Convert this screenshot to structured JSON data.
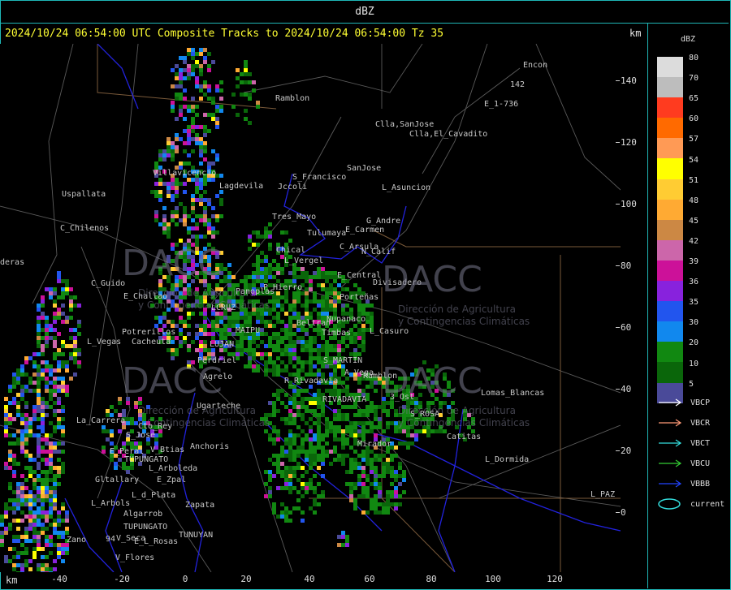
{
  "window": {
    "title": "dBZ"
  },
  "status_line": "2024/10/24 06:54:00 UTC Composite Tracks to 2024/10/24 06:54:00 Tz 35",
  "axis": {
    "unit_top": "km",
    "unit_bottom": "km",
    "y_ticks": [
      "140",
      "120",
      "100",
      "80",
      "60",
      "40",
      "20",
      "0"
    ],
    "x_ticks": [
      "-40",
      "-20",
      "0",
      "20",
      "40",
      "60",
      "80",
      "100",
      "120"
    ]
  },
  "legend": {
    "title": "dBZ",
    "levels": [
      {
        "label": "80",
        "color": "#dcdcdc"
      },
      {
        "label": "70",
        "color": "#bdbdbd"
      },
      {
        "label": "65",
        "color": "#ff3b1f"
      },
      {
        "label": "60",
        "color": "#ff6a00"
      },
      {
        "label": "57",
        "color": "#ff9a55"
      },
      {
        "label": "54",
        "color": "#ffff00"
      },
      {
        "label": "51",
        "color": "#ffcc33"
      },
      {
        "label": "48",
        "color": "#ffaa33"
      },
      {
        "label": "45",
        "color": "#cc8844"
      },
      {
        "label": "42",
        "color": "#cc66aa"
      },
      {
        "label": "39",
        "color": "#cc1199"
      },
      {
        "label": "36",
        "color": "#8822dd"
      },
      {
        "label": "35",
        "color": "#2255ee"
      },
      {
        "label": "30",
        "color": "#1188ee"
      },
      {
        "label": "20",
        "color": "#118811"
      },
      {
        "label": "10",
        "color": "#0a660a"
      },
      {
        "label": "5",
        "color": "#4a4a99"
      }
    ],
    "tracks": [
      {
        "label": "VBCP",
        "color": "#ffffff",
        "icon": "arrow-icon"
      },
      {
        "label": "VBCR",
        "color": "#ff9977",
        "icon": "arrow-icon"
      },
      {
        "label": "VBCT",
        "color": "#33dddd",
        "icon": "arrow-icon"
      },
      {
        "label": "VBCU",
        "color": "#33cc33",
        "icon": "arrow-icon"
      },
      {
        "label": "VBBB",
        "color": "#2244ff",
        "icon": "arrow-icon"
      },
      {
        "label": "current",
        "color": "#33dddd",
        "icon": "ellipse-icon"
      }
    ]
  },
  "places": [
    {
      "name": "Ramblon"
    },
    {
      "name": "Encon"
    },
    {
      "name": "E_1-736"
    },
    {
      "name": "Clla,SanJose"
    },
    {
      "name": "Clla,El_Cavadito"
    },
    {
      "name": "SanJose"
    },
    {
      "name": "S_Francisco"
    },
    {
      "name": "Jccoli"
    },
    {
      "name": "Villavicencio"
    },
    {
      "name": "Lagdevila"
    },
    {
      "name": "Uspallata"
    },
    {
      "name": "L_Asuncion"
    },
    {
      "name": "Tres_Mayo"
    },
    {
      "name": "G_Andre"
    },
    {
      "name": "Tulumaya"
    },
    {
      "name": "E_Carmen"
    },
    {
      "name": "C_Chilenos"
    },
    {
      "name": "C_Arsula"
    },
    {
      "name": "Chical"
    },
    {
      "name": "L_Vergel"
    },
    {
      "name": "N_Calif"
    },
    {
      "name": "E_Central"
    },
    {
      "name": "Divisadero"
    },
    {
      "name": "C_Guido"
    },
    {
      "name": "deras"
    },
    {
      "name": "P_Hierro"
    },
    {
      "name": "Panoplas"
    },
    {
      "name": "E_Challao"
    },
    {
      "name": "Porteñas"
    },
    {
      "name": "LCRUZ"
    },
    {
      "name": "Beltran"
    },
    {
      "name": "Nupanaco"
    },
    {
      "name": "Potrerillos"
    },
    {
      "name": "MAIPU"
    },
    {
      "name": "Timbas"
    },
    {
      "name": "L_Casuro"
    },
    {
      "name": "L_Vegas"
    },
    {
      "name": "Cacheuta"
    },
    {
      "name": "LUJAN"
    },
    {
      "name": "S_MARTIN"
    },
    {
      "name": "Perdriel"
    },
    {
      "name": "Agrelo"
    },
    {
      "name": "A_Vega"
    },
    {
      "name": "Ramblon"
    },
    {
      "name": "R_Rivadavia"
    },
    {
      "name": "Lomas_Blancas"
    },
    {
      "name": "Ugarteche"
    },
    {
      "name": "RIVADAVIA"
    },
    {
      "name": "3_Ost"
    },
    {
      "name": "La_Carrera"
    },
    {
      "name": "Cto_Rey"
    },
    {
      "name": "S_ROSA"
    },
    {
      "name": "S_Jose"
    },
    {
      "name": "Catitas"
    },
    {
      "name": "Anchoris"
    },
    {
      "name": "E_Peral"
    },
    {
      "name": "V_Btias"
    },
    {
      "name": "Mirador"
    },
    {
      "name": "TUPUNGATO"
    },
    {
      "name": "L_Dormida"
    },
    {
      "name": "L_Arboleda"
    },
    {
      "name": "Gltallary"
    },
    {
      "name": "E_Zpal"
    },
    {
      "name": "L_PAZ"
    },
    {
      "name": "L_d_Plata"
    },
    {
      "name": "L_Arbols"
    },
    {
      "name": "Zapata"
    },
    {
      "name": "Algarrob"
    },
    {
      "name": "TUPUNGATO"
    },
    {
      "name": "V_Seca"
    },
    {
      "name": "Zano"
    },
    {
      "name": "E_L_Rosas"
    },
    {
      "name": "TUNUYAN"
    },
    {
      "name": "V_Flores"
    },
    {
      "name": "142"
    },
    {
      "name": "94"
    }
  ],
  "watermark": {
    "logo": "DACC",
    "subtitle_1": "Dirección de Agricultura",
    "subtitle_2": "y Contingencias Climáticas"
  }
}
